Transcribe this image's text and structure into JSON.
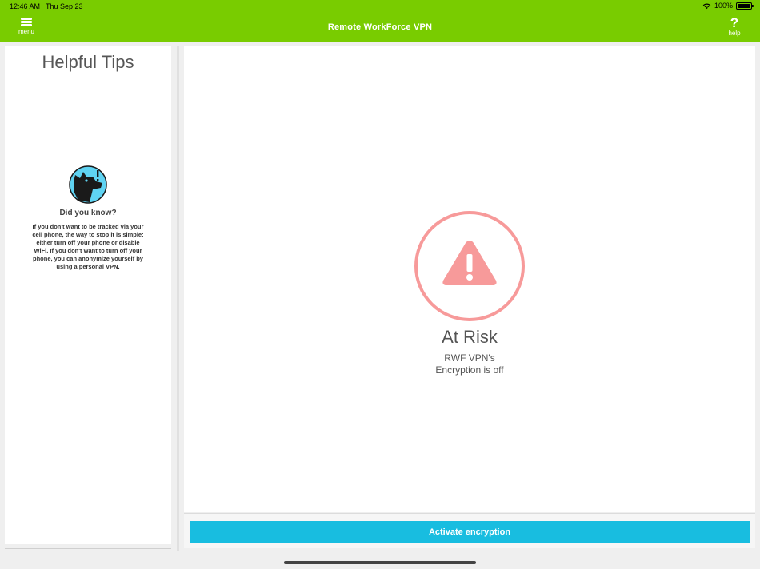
{
  "status_bar": {
    "time": "12:46 AM",
    "date": "Thu Sep 23",
    "battery": "100%"
  },
  "header": {
    "title": "Remote WorkForce VPN",
    "menu_label": "menu",
    "help_label": "help",
    "help_glyph": "?",
    "color": "#79cc00"
  },
  "tips": {
    "title": "Helpful Tips",
    "heading": "Did you know?",
    "text": "If you don't want to be tracked via your cell phone, the way to stop it is simple: either turn off your phone or disable WiFi. If you don't want to turn off your phone, you can anonymize yourself by using a personal VPN.",
    "icon": "dog-icon"
  },
  "status": {
    "title": "At Risk",
    "line1": "RWF VPN's",
    "line2": "Encryption is off",
    "icon": "warning-icon",
    "color": "#f79a9a"
  },
  "action": {
    "label": "Activate encryption",
    "color": "#18bde0"
  }
}
